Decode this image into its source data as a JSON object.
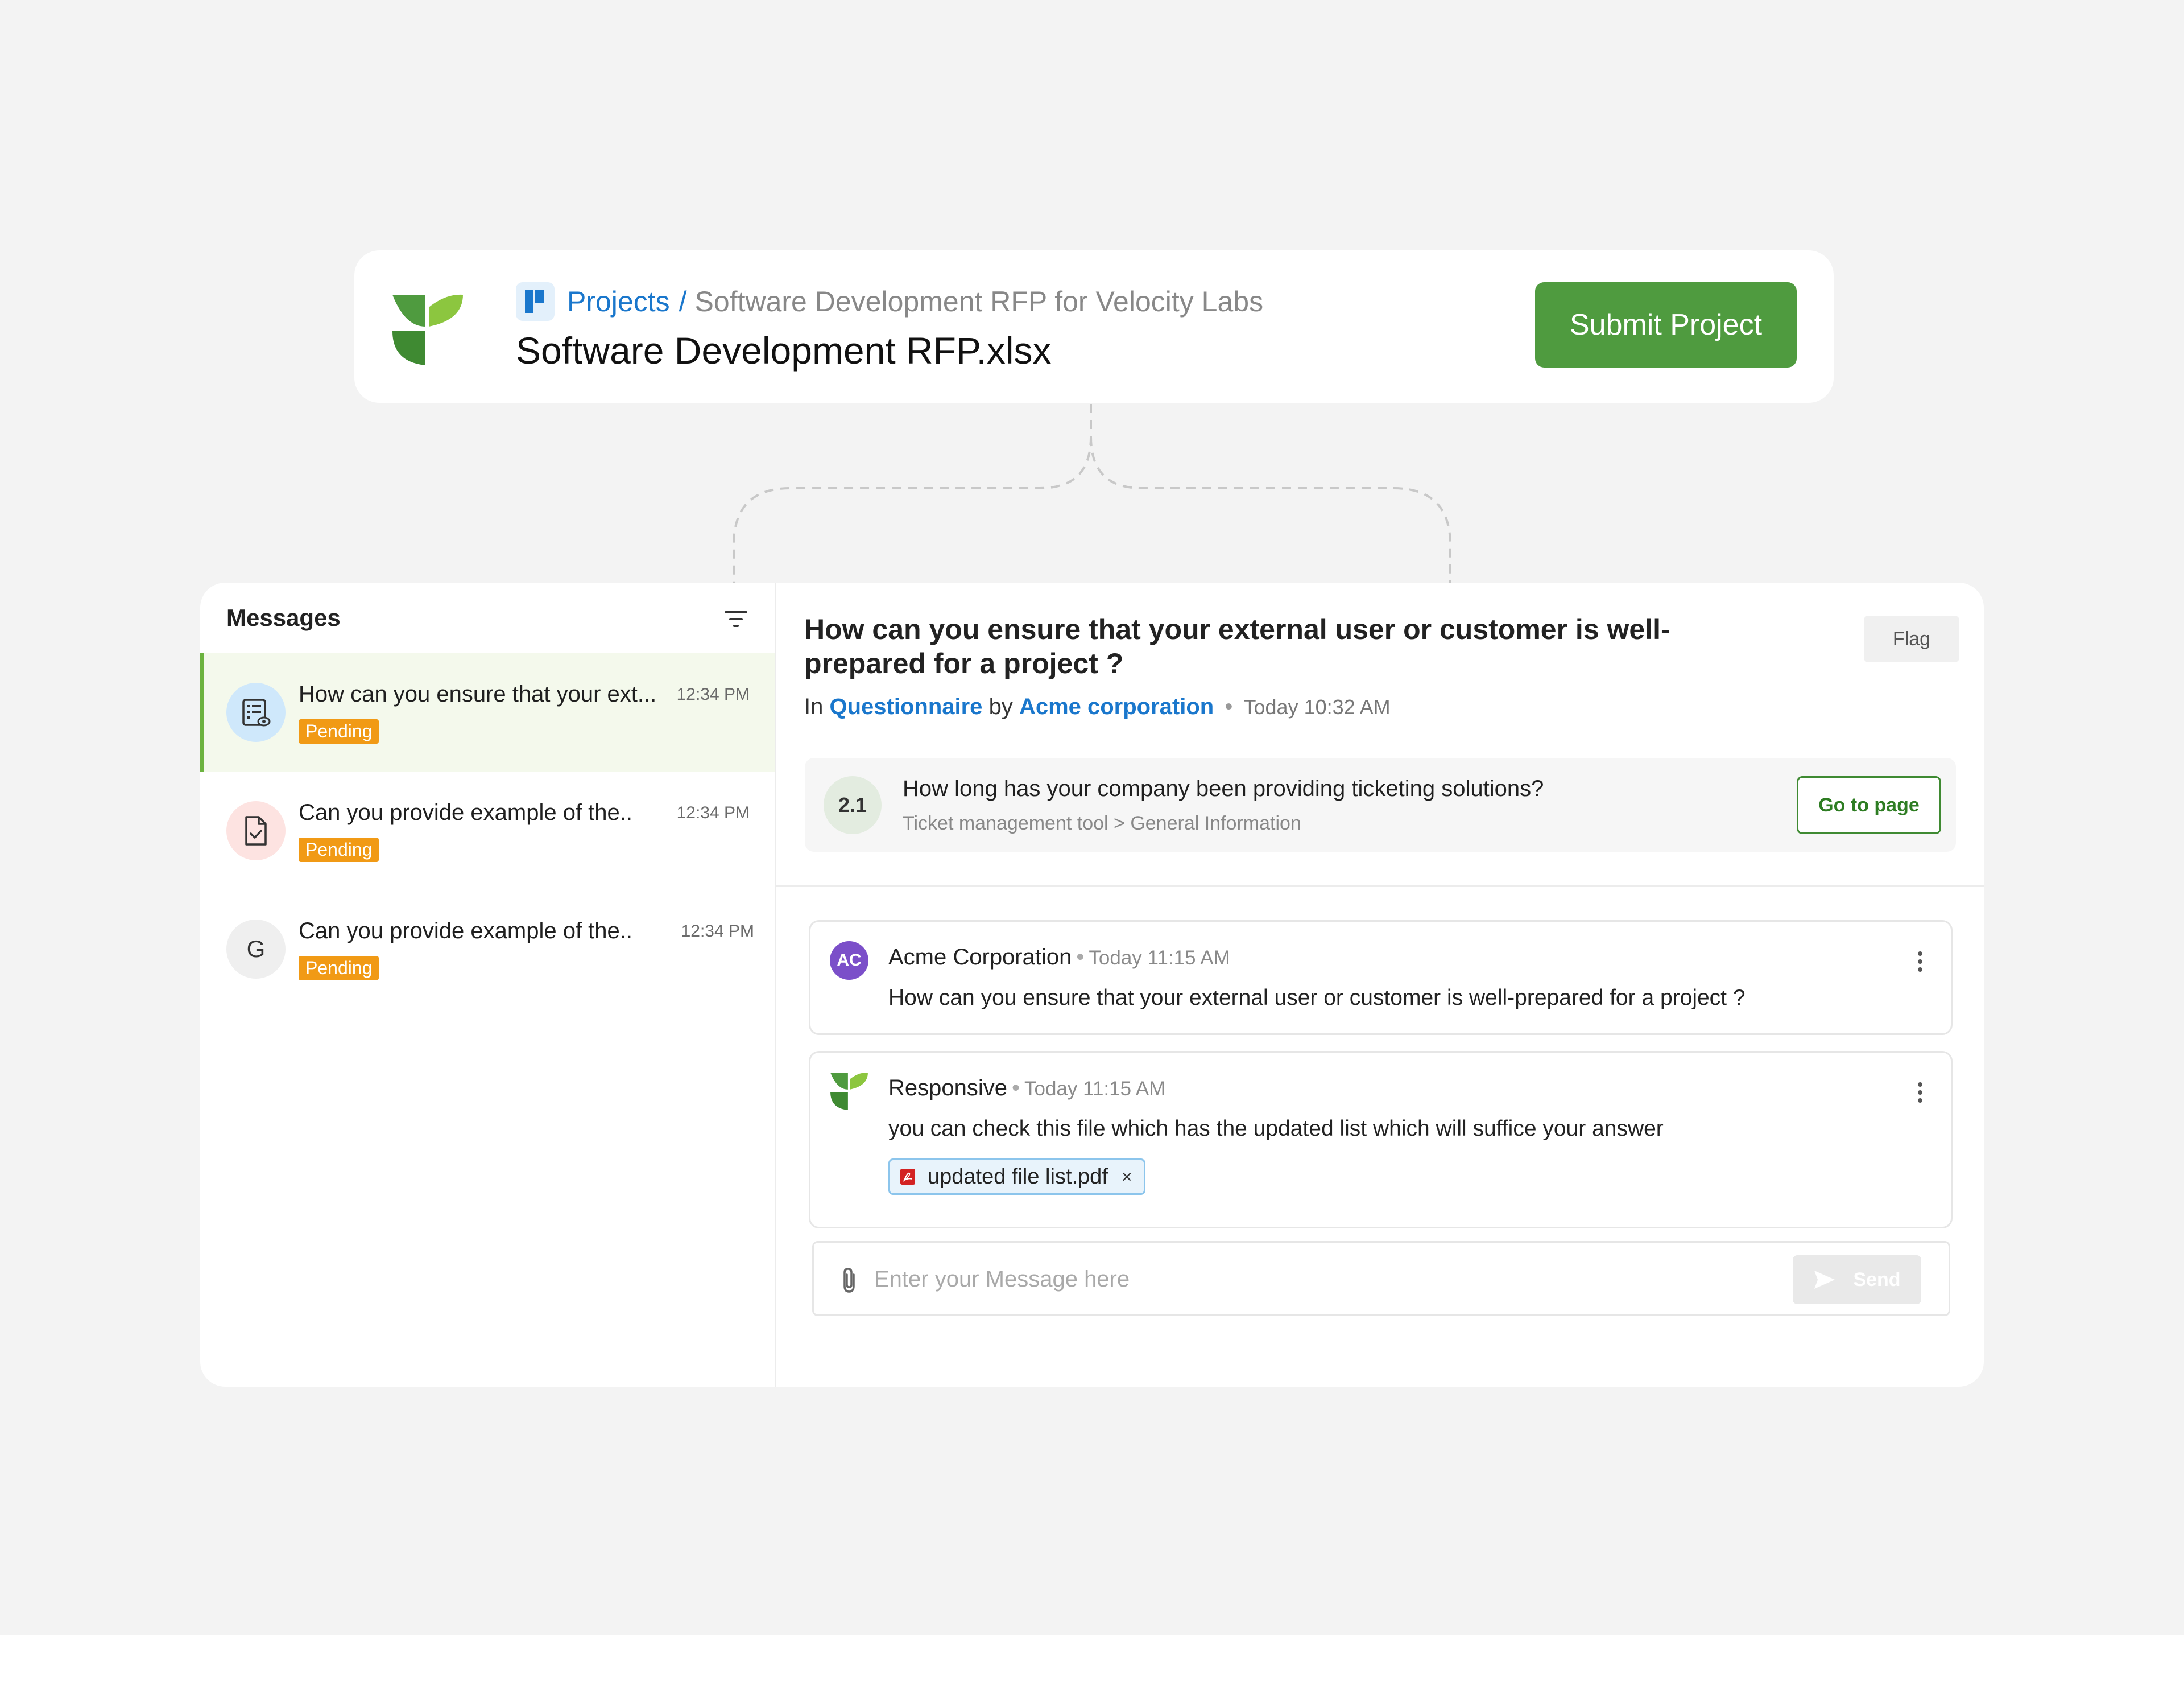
{
  "header": {
    "breadcrumb_root": "Projects",
    "breadcrumb_separator": "/",
    "breadcrumb_current": "Software Development RFP for Velocity Labs",
    "file_title": "Software Development RFP.xlsx",
    "submit_label": "Submit Project"
  },
  "messages": {
    "title": "Messages",
    "items": [
      {
        "text": "How can you ensure that your ext...",
        "time": "12:34 PM",
        "status": "Pending",
        "icon": "questionnaire-icon"
      },
      {
        "text": "Can you provide example of the..",
        "time": "12:34 PM",
        "status": "Pending",
        "icon": "document-check-icon"
      },
      {
        "text": "Can you provide example of the..",
        "time": "12:34 PM",
        "status": "Pending",
        "initial": "G"
      }
    ]
  },
  "detail": {
    "question_title": "How can you ensure that your external user or customer is well-prepared for a project ?",
    "flag_label": "Flag",
    "meta_in": "In",
    "meta_source": "Questionnaire",
    "meta_by": "by",
    "meta_org": "Acme corporation",
    "meta_separator": "•",
    "meta_time": "Today 10:32 AM",
    "reference": {
      "number": "2.1",
      "question": "How long has your company been providing ticketing solutions?",
      "path": "Ticket management tool > General Information",
      "go_label": "Go to page"
    },
    "comments": [
      {
        "initials": "AC",
        "author": "Acme Corporation",
        "separator": "•",
        "time": "Today 11:15 AM",
        "body": "How can you ensure that your external user or customer is well-prepared for a project ?"
      },
      {
        "author": "Responsive",
        "separator": "•",
        "time": "Today 11:15 AM",
        "body": "you can check this file which has the updated list which will suffice your answer",
        "attachment": "updated file list.pdf",
        "remove": "×"
      }
    ],
    "composer": {
      "placeholder": "Enter your Message here",
      "send_label": "Send"
    }
  },
  "colors": {
    "accent_green": "#4f9b3f",
    "link_blue": "#1a77cc",
    "pending_orange": "#f19a15",
    "avatar_purple": "#7b4fc9"
  }
}
